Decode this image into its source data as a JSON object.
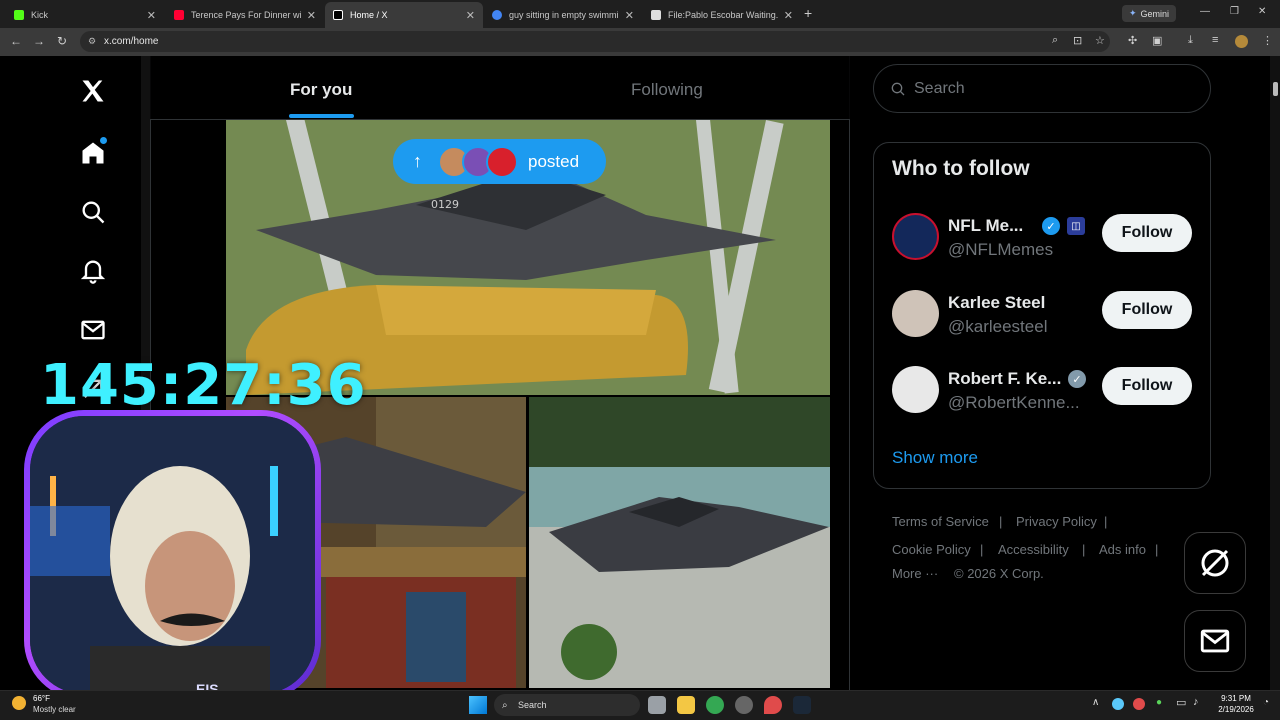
{
  "browser": {
    "tabs": [
      {
        "title": "Kick",
        "color": "#53fc18"
      },
      {
        "title": "Terence Pays For Dinner with Sp",
        "color": "#ff0033"
      },
      {
        "title": "Home / X",
        "color": "#ffffff"
      },
      {
        "title": "guy sitting in empty swimming",
        "color": "#4285f4"
      },
      {
        "title": "File:Pablo Escobar Waiting.jpg",
        "color": "#dddddd"
      }
    ],
    "gemini_label": "Gemini",
    "url": "x.com/home"
  },
  "x": {
    "feed_tabs": {
      "for_you": "For you",
      "following": "Following"
    },
    "posted_pill": {
      "label": "posted"
    },
    "search_placeholder": "Search",
    "who_to_follow": {
      "title": "Who to follow",
      "accounts": [
        {
          "name": "NFL Me...",
          "handle": "@NFLMemes",
          "verified": "blue",
          "button": "Follow"
        },
        {
          "name": "Karlee Steel",
          "handle": "@karleesteel",
          "verified": "none",
          "button": "Follow"
        },
        {
          "name": "Robert F. Ke...",
          "handle": "@RobertKenne...",
          "verified": "grey",
          "button": "Follow"
        }
      ],
      "show_more": "Show more"
    },
    "footer": {
      "terms": "Terms of Service",
      "privacy": "Privacy Policy",
      "cookie": "Cookie Policy",
      "accessibility": "Accessibility",
      "ads": "Ads info",
      "more": "More ···",
      "copyright": "© 2026 X Corp.",
      "sep": "|"
    }
  },
  "overlay": {
    "timer": "145:27:36",
    "webcam_label": "EIS"
  },
  "taskbar": {
    "weather_temp": "66°F",
    "weather_desc": "Mostly clear",
    "search_label": "Search",
    "time": "9:31 PM",
    "date": "2/19/2026"
  },
  "colors": {
    "accent": "#1d9bf0",
    "timer": "#3ff0ff"
  }
}
